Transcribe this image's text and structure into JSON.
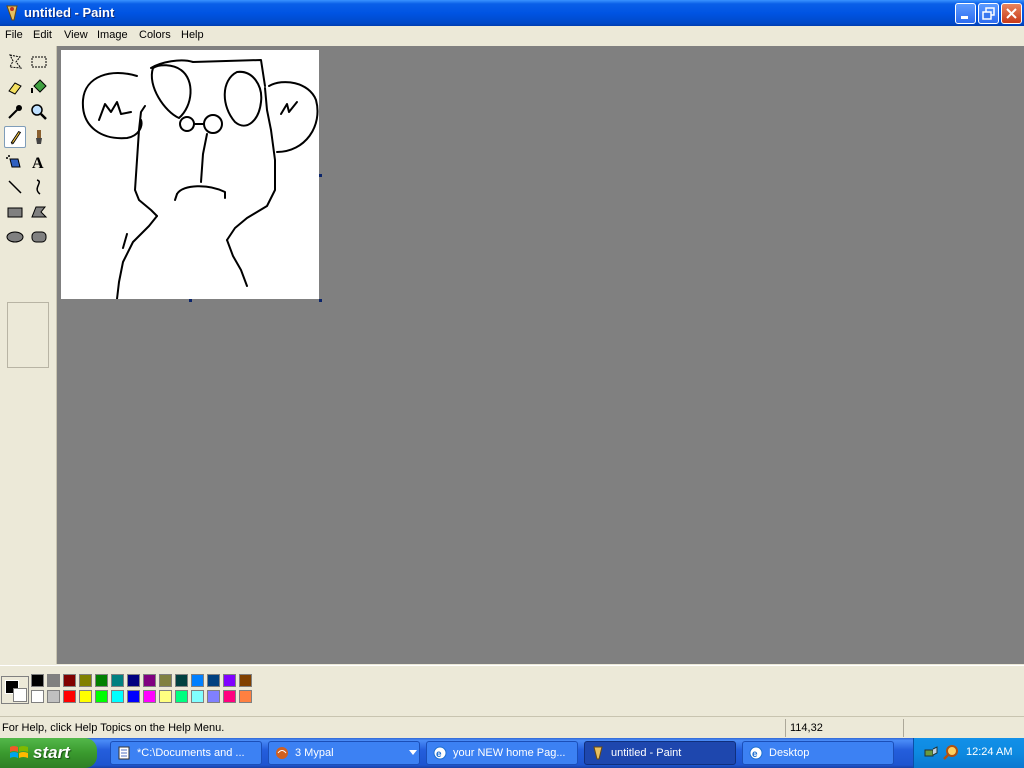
{
  "window": {
    "title": "untitled - Paint"
  },
  "menu": [
    {
      "label": "File"
    },
    {
      "label": "Edit"
    },
    {
      "label": "View"
    },
    {
      "label": "Image"
    },
    {
      "label": "Colors"
    },
    {
      "label": "Help"
    }
  ],
  "tools": [
    "free-form-select",
    "select",
    "eraser",
    "fill-with-color",
    "pick-color",
    "magnifier",
    "pencil",
    "brush",
    "airbrush",
    "text",
    "line",
    "curve",
    "rectangle",
    "polygon",
    "ellipse",
    "rounded-rectangle"
  ],
  "selected_tool": "pencil",
  "colors": {
    "foreground": "#000000",
    "background": "#FFFFFF",
    "palette_row1": [
      "#000000",
      "#808080",
      "#800000",
      "#808000",
      "#008000",
      "#008080",
      "#000080",
      "#800080",
      "#808040",
      "#004040",
      "#0080FF",
      "#004080",
      "#8000FF",
      "#804000"
    ],
    "palette_row2": [
      "#FFFFFF",
      "#C0C0C0",
      "#FF0000",
      "#FFFF00",
      "#00FF00",
      "#00FFFF",
      "#0000FF",
      "#FF00FF",
      "#FFFF80",
      "#00FF80",
      "#80FFFF",
      "#8080FF",
      "#FF0080",
      "#FF8040"
    ],
    "workspace": "#808080",
    "canvas": "#FFFFFF"
  },
  "status": {
    "help_text": "For Help, click Help Topics on the Help Menu.",
    "coordinates": "114,32"
  },
  "taskbar": {
    "start_label": "start",
    "tasks": [
      {
        "label": "*C:\\Documents and ...",
        "icon": "notepad-icon",
        "active": false
      },
      {
        "label": "3 Mypal",
        "icon": "browser-icon",
        "active": false
      },
      {
        "label": "your NEW home Pag...",
        "icon": "ie-icon",
        "active": false
      },
      {
        "label": "untitled - Paint",
        "icon": "paint-icon",
        "active": true
      },
      {
        "label": "Desktop",
        "icon": "desktop-icon",
        "active": false
      }
    ],
    "clock": "12:24 AM"
  }
}
